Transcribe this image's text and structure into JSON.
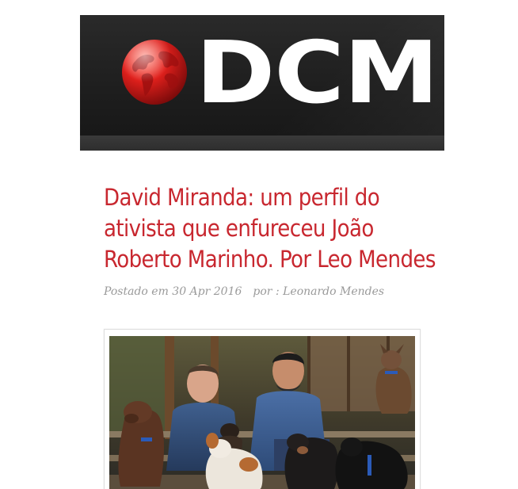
{
  "site": {
    "logo_text": "DCM",
    "colors": {
      "brand_red": "#c8272f",
      "banner_bg": "#1e1e1e"
    }
  },
  "article": {
    "title": "David Miranda: um perfil do ativista que enfureceu João Roberto Marinho. Por Leo Mendes",
    "posted_label": "Postado em 30 Apr 2016",
    "author_label": "por : Leonardo Mendes",
    "image_description": "featured photo: two men seated on porch steps with dogs"
  },
  "icons": {
    "globe": "globe-icon"
  }
}
